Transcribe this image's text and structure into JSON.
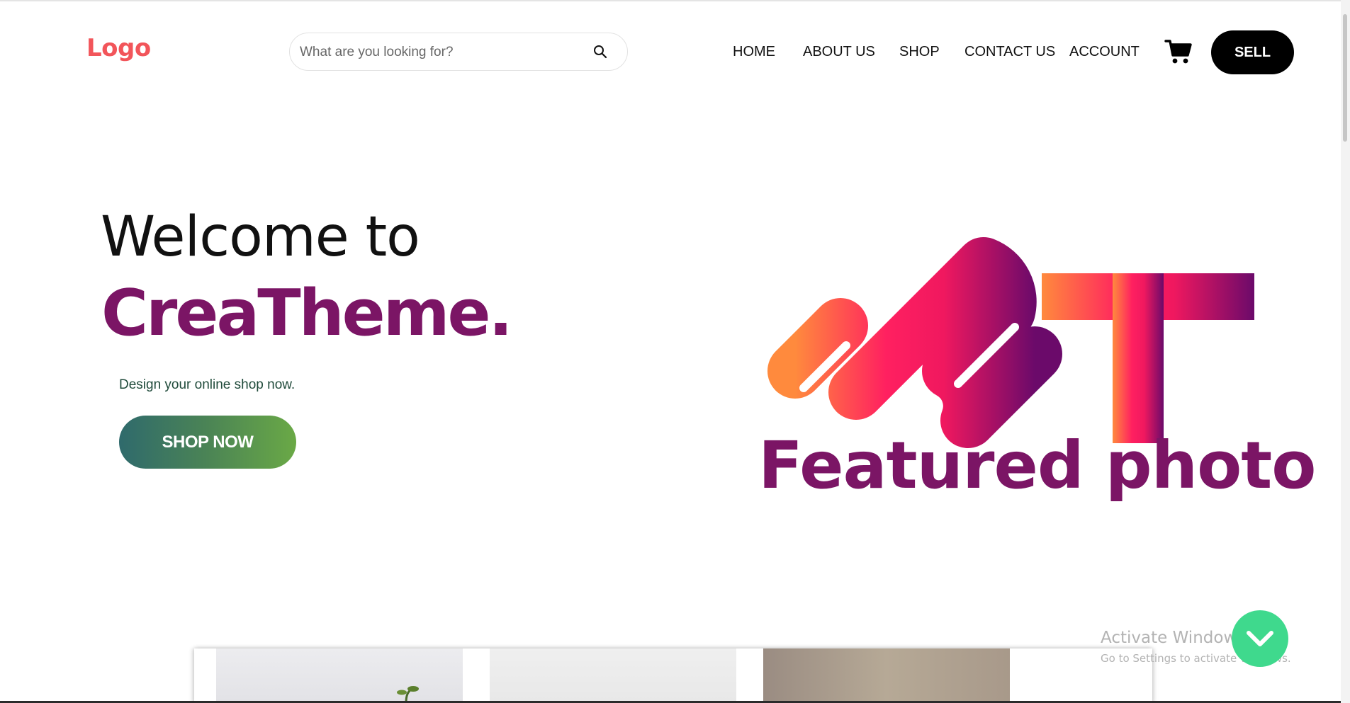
{
  "header": {
    "logo": "Logo",
    "search": {
      "placeholder": "What are you looking for?",
      "value": ""
    },
    "nav": [
      "HOME",
      "ABOUT US",
      "SHOP",
      "CONTACT US",
      "ACCOUNT"
    ],
    "sell_label": "SELL"
  },
  "hero": {
    "welcome": "Welcome to",
    "brand": "CreaTheme.",
    "tagline": "Design your online shop now.",
    "cta_label": "SHOP NOW",
    "featured_caption": "Featured photo"
  },
  "watermark": {
    "title": "Activate Windows",
    "subtitle": "Go to Settings to activate Windows."
  },
  "colors": {
    "logo": "#f2555a",
    "brand": "#7b1565",
    "cta_gradient_start": "#2f6a6c",
    "cta_gradient_end": "#6aa946",
    "scroll_button": "#3fd98d",
    "mark_gradient": [
      "#ff8a3d",
      "#ff2060",
      "#6b0a6a"
    ]
  },
  "icons": {
    "search": "search-icon",
    "cart": "cart-icon",
    "scroll": "chevron-down-icon"
  }
}
